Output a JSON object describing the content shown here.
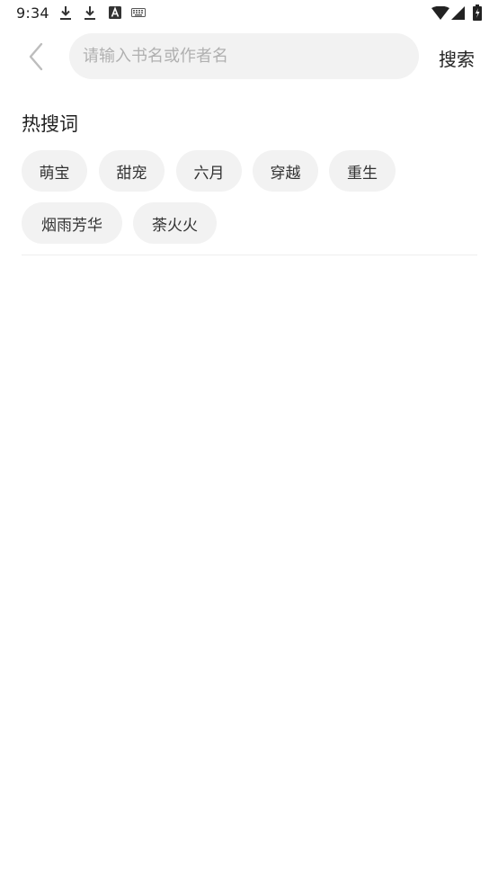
{
  "status_bar": {
    "time": "9:34",
    "icons": [
      "download-icon",
      "download-icon",
      "font-a-icon",
      "keyboard-icon",
      "wifi-icon",
      "signal-icon",
      "battery-icon"
    ]
  },
  "search": {
    "placeholder": "请输入书名或作者名",
    "value": "",
    "button_label": "搜索"
  },
  "hot_search": {
    "title": "热搜词",
    "tags": [
      "萌宝",
      "甜宠",
      "六月",
      "穿越",
      "重生",
      "烟雨芳华",
      "荼火火"
    ]
  }
}
